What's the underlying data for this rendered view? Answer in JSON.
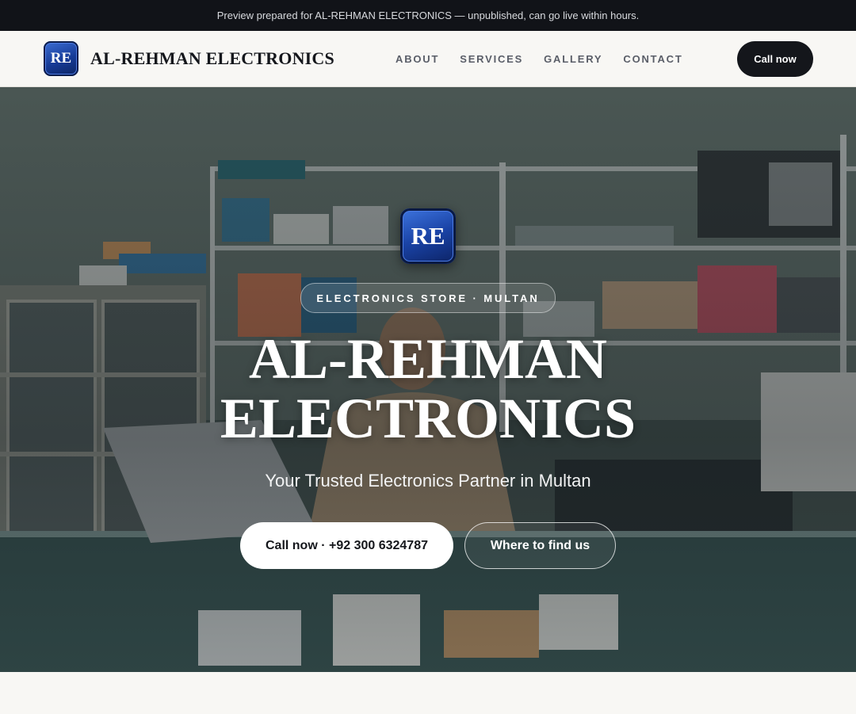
{
  "preview_banner": "Preview prepared for AL-REHMAN ELECTRONICS — unpublished, can go live within hours.",
  "header": {
    "logo_text": "RE",
    "brand_name": "AL-REHMAN ELECTRONICS",
    "nav": [
      "ABOUT",
      "SERVICES",
      "GALLERY",
      "CONTACT"
    ],
    "cta_label": "Call now"
  },
  "hero": {
    "logo_text": "RE",
    "tag": "ELECTRONICS STORE · MULTAN",
    "title_line1": "AL-REHMAN",
    "title_line2": "ELECTRONICS",
    "subtitle": "Your Trusted Electronics Partner in Multan",
    "primary_button": "Call now · +92 300 6324787",
    "secondary_button": "Where to find us",
    "background_image": "electronics shop interior with shopkeeper at laptop"
  },
  "colors": {
    "accent_dark": "#14161b",
    "logo_blue": "#1a43a6",
    "page_bg": "#f8f7f4"
  }
}
